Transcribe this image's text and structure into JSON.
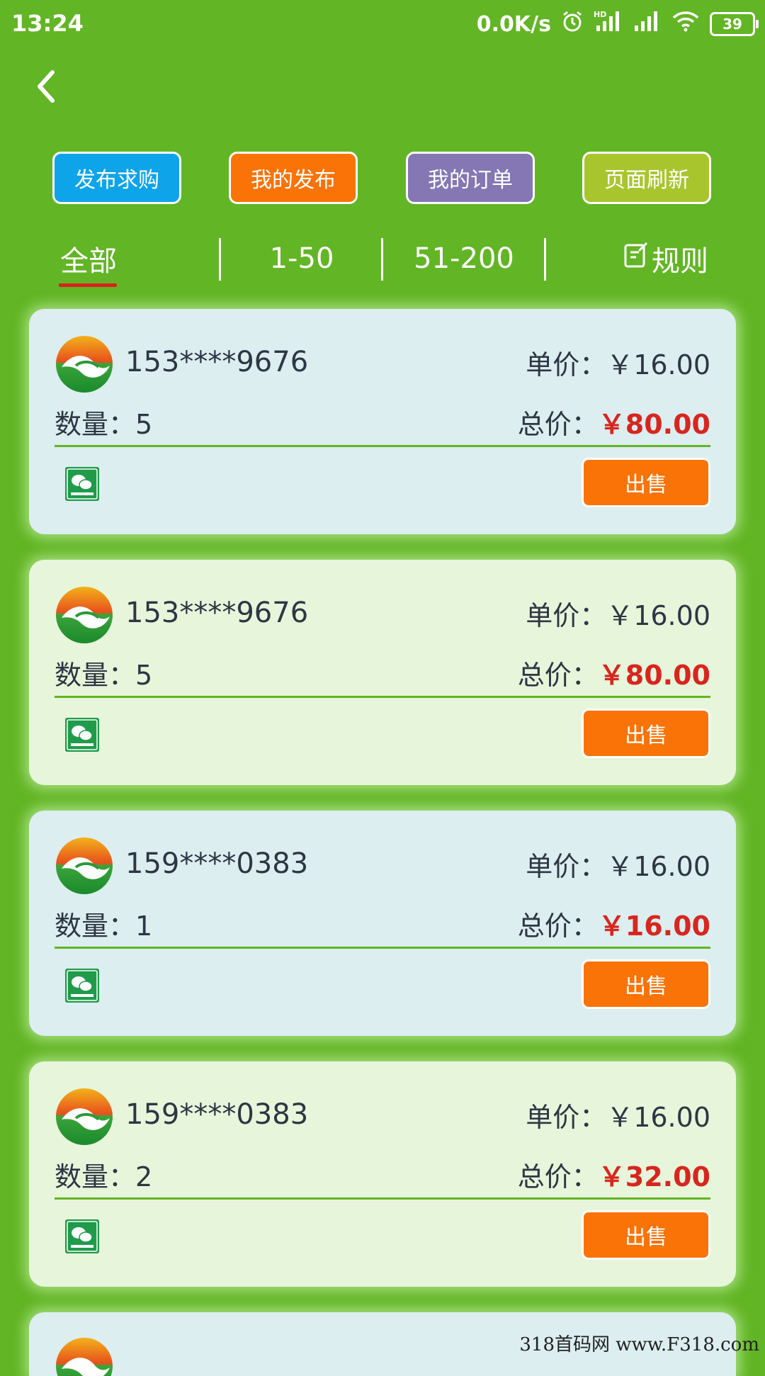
{
  "status_bar": {
    "time": "13:24",
    "speed": "0.0K/s",
    "hd_label": "HD",
    "battery": "39"
  },
  "actions": [
    {
      "label": "发布求购",
      "color": "#0ea4ea"
    },
    {
      "label": "我的发布",
      "color": "#fa7306"
    },
    {
      "label": "我的订单",
      "color": "#8477b4"
    },
    {
      "label": "页面刷新",
      "color": "#a9c52d"
    }
  ],
  "tabs": [
    {
      "label": "全部",
      "selected": true
    },
    {
      "label": "1-50",
      "selected": false
    },
    {
      "label": "51-200",
      "selected": false
    },
    {
      "label": "规则",
      "selected": false,
      "icon": "edit-note-icon"
    }
  ],
  "listings": [
    {
      "phone": "153****9676",
      "unit_price_label": "单价：",
      "unit_price": "￥16.00",
      "qty_label": "数量：",
      "qty": "5",
      "total_label": "总价：",
      "total": "￥80.00",
      "button": "出售"
    },
    {
      "phone": "153****9676",
      "unit_price_label": "单价：",
      "unit_price": "￥16.00",
      "qty_label": "数量：",
      "qty": "5",
      "total_label": "总价：",
      "total": "￥80.00",
      "button": "出售"
    },
    {
      "phone": "159****0383",
      "unit_price_label": "单价：",
      "unit_price": "￥16.00",
      "qty_label": "数量：",
      "qty": "1",
      "total_label": "总价：",
      "total": "￥16.00",
      "button": "出售"
    },
    {
      "phone": "159****0383",
      "unit_price_label": "单价：",
      "unit_price": "￥16.00",
      "qty_label": "数量：",
      "qty": "2",
      "total_label": "总价：",
      "total": "￥32.00",
      "button": "出售"
    }
  ],
  "watermark": "318首码网 www.F318.com"
}
